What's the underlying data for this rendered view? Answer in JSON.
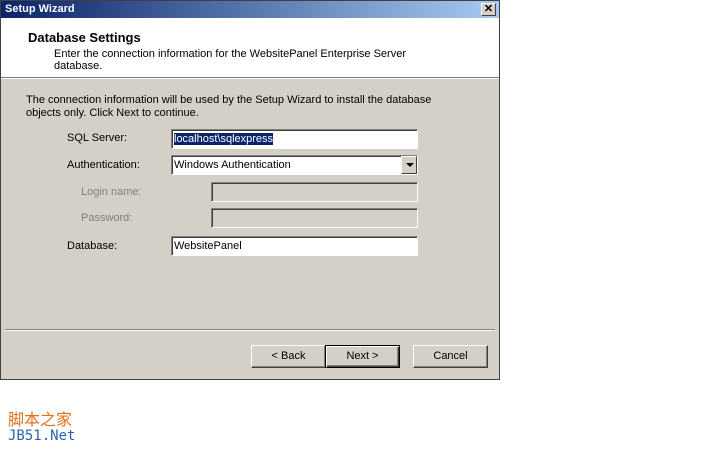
{
  "window": {
    "title": "Setup Wizard",
    "close_glyph": "✕"
  },
  "header": {
    "title": "Database Settings",
    "description": "Enter the connection information for the WebsitePanel Enterprise Server database."
  },
  "intro_text": "The connection information will be used by the Setup Wizard to install the database objects only. Click Next to continue.",
  "form": {
    "sql_server": {
      "label": "SQL Server:",
      "value": "localhost\\sqlexpress"
    },
    "authentication": {
      "label": "Authentication:",
      "selected": "Windows Authentication"
    },
    "login_name": {
      "label": "Login name:",
      "value": ""
    },
    "password": {
      "label": "Password:",
      "value": ""
    },
    "database": {
      "label": "Database:",
      "value": "WebsitePanel"
    }
  },
  "buttons": {
    "back": "< Back",
    "next": "Next >",
    "cancel": "Cancel"
  },
  "watermark": {
    "line1": "脚本之家",
    "line2": "JB51.Net"
  },
  "colors": {
    "title_bar": "#0a246a",
    "dialog_bg": "#d4d0c8",
    "watermark_orange": "#e07020",
    "watermark_blue": "#2a63b0"
  }
}
